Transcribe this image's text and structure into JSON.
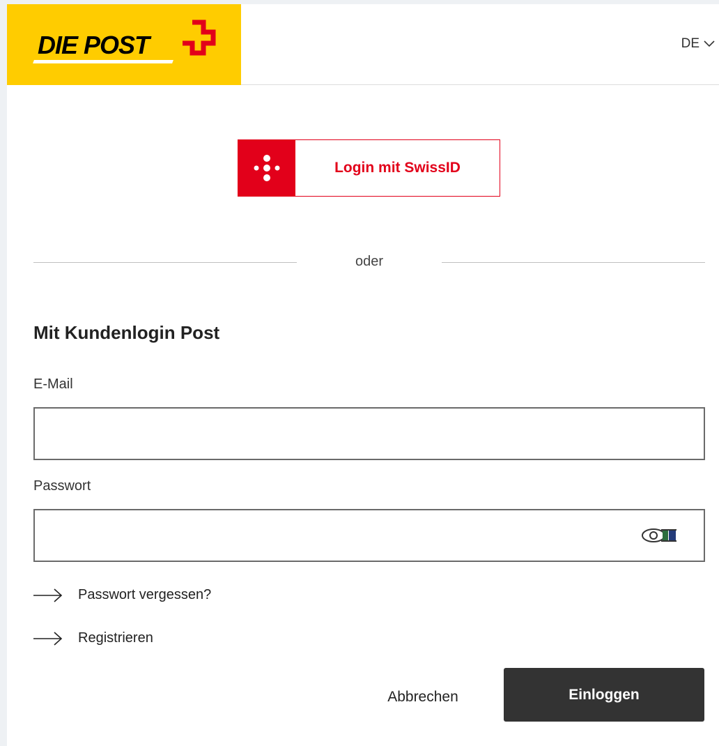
{
  "header": {
    "logo_text": "DIE POST",
    "language": "DE",
    "brand_color": "#ffcc00",
    "cross_color": "#e2001a"
  },
  "swissid": {
    "label": "Login mit SwissID",
    "accent": "#e2001a",
    "icon": "swissid-dots-icon"
  },
  "divider": {
    "label": "oder"
  },
  "form": {
    "title": "Mit Kundenlogin Post",
    "email_label": "E-Mail",
    "email_value": "",
    "password_label": "Passwort",
    "password_value": "",
    "password_toggle_icon": "eye-icon"
  },
  "links": {
    "forgot_password": "Passwort vergessen?",
    "register": "Registrieren"
  },
  "actions": {
    "cancel_label": "Abbrechen",
    "login_label": "Einloggen"
  }
}
